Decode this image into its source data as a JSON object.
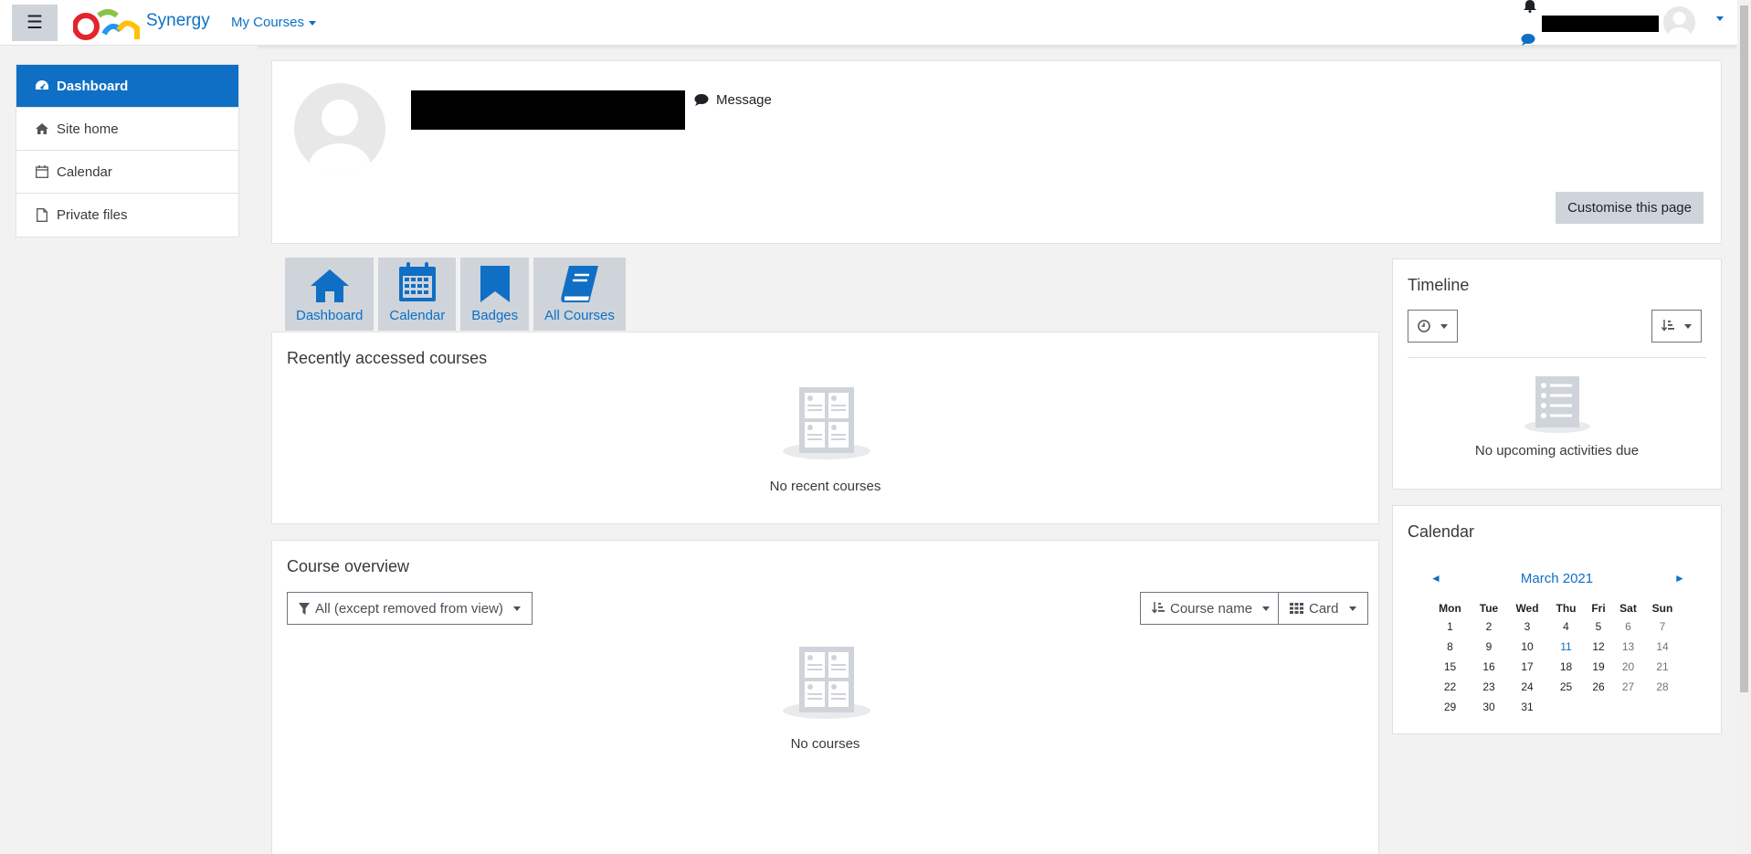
{
  "navbar": {
    "brand": "Synergy",
    "my_courses": "My Courses"
  },
  "drawer": {
    "items": [
      {
        "label": "Dashboard",
        "icon": "dashboard-icon",
        "active": true
      },
      {
        "label": "Site home",
        "icon": "home-icon",
        "active": false
      },
      {
        "label": "Calendar",
        "icon": "calendar-icon",
        "active": false
      },
      {
        "label": "Private files",
        "icon": "file-icon",
        "active": false
      }
    ]
  },
  "header": {
    "message_label": "Message",
    "customise_label": "Customise this page"
  },
  "tabs": [
    {
      "label": "Dashboard",
      "icon": "home-icon"
    },
    {
      "label": "Calendar",
      "icon": "calendar-icon"
    },
    {
      "label": "Badges",
      "icon": "bookmark-icon"
    },
    {
      "label": "All Courses",
      "icon": "book-icon"
    }
  ],
  "recent": {
    "title": "Recently accessed courses",
    "empty": "No recent courses"
  },
  "overview": {
    "title": "Course overview",
    "filter": "All (except removed from view)",
    "sort": "Course name",
    "view": "Card",
    "empty": "No courses"
  },
  "timeline": {
    "title": "Timeline",
    "empty": "No upcoming activities due"
  },
  "calendar": {
    "title": "Calendar",
    "month": "March 2021",
    "days": [
      "Mon",
      "Tue",
      "Wed",
      "Thu",
      "Fri",
      "Sat",
      "Sun"
    ],
    "weeks": [
      [
        "1",
        "2",
        "3",
        "4",
        "5",
        "6",
        "7"
      ],
      [
        "8",
        "9",
        "10",
        "11",
        "12",
        "13",
        "14"
      ],
      [
        "15",
        "16",
        "17",
        "18",
        "19",
        "20",
        "21"
      ],
      [
        "22",
        "23",
        "24",
        "25",
        "26",
        "27",
        "28"
      ],
      [
        "29",
        "30",
        "31",
        "",
        "",
        "",
        ""
      ]
    ],
    "today": "11"
  },
  "colors": {
    "accent": "#0f6fc5",
    "tab_bg": "#ced4da"
  }
}
